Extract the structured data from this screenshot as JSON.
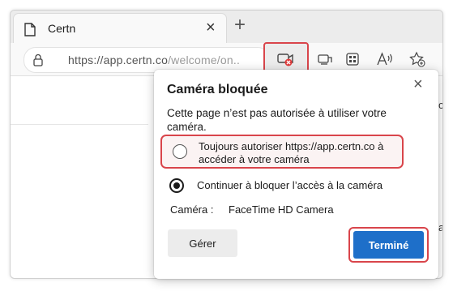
{
  "tab": {
    "title": "Certn",
    "close_icon": "close-icon",
    "new_tab_icon": "plus-icon"
  },
  "address_bar": {
    "host": "https://app.certn.co",
    "path": "/welcome/on.."
  },
  "toolbar_icons": [
    "camera-blocked-icon",
    "tab-view-icon",
    "apps-icon",
    "read-aloud-icon",
    "favorites-add-icon"
  ],
  "page_fragments": {
    "right_top": "c",
    "right_mid": "a"
  },
  "popup": {
    "title": "Caméra bloquée",
    "description": "Cette page n’est pas autorisée à utiliser votre caméra.",
    "option_allow": "Toujours autoriser https://app.certn.co à accéder à votre caméra",
    "option_block": "Continuer à bloquer l’accès à la caméra",
    "selected_option": "option_block",
    "camera_label": "Caméra :",
    "camera_value": "FaceTime HD Camera",
    "manage_button": "Gérer",
    "done_button": "Terminé"
  },
  "colors": {
    "highlight": "#d9454b",
    "primary_button": "#1e6fc9"
  }
}
